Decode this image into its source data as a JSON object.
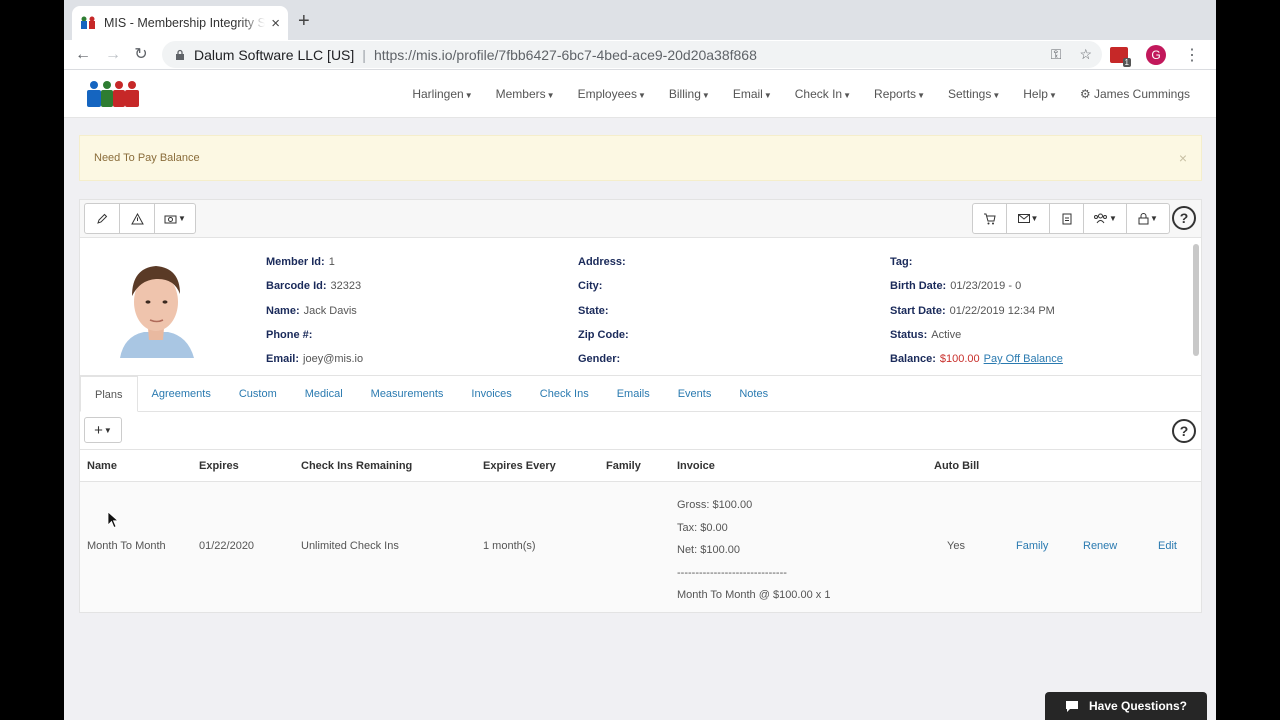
{
  "browser": {
    "tab_title": "MIS - Membership Integrity System",
    "new_tab": "+",
    "tab_close": "×",
    "site_name": "Dalum Software LLC [US]",
    "separator": "|",
    "url": "https://mis.io/profile/7fbb6427-6bc7-4bed-ace9-20d20a38f868",
    "profile_initial": "G",
    "extension_badge": "1"
  },
  "nav": {
    "items": [
      "Harlingen",
      "Members",
      "Employees",
      "Billing",
      "Email",
      "Check In",
      "Reports",
      "Settings",
      "Help"
    ],
    "user": "James Cummings"
  },
  "alert": {
    "message": "Need To Pay Balance",
    "close": "×"
  },
  "profile": {
    "col1": [
      {
        "label": "Member Id:",
        "value": "1"
      },
      {
        "label": "Barcode Id:",
        "value": "32323"
      },
      {
        "label": "Name:",
        "value": "Jack Davis"
      },
      {
        "label": "Phone #:",
        "value": ""
      },
      {
        "label": "Email:",
        "value": "joey@mis.io"
      }
    ],
    "col2": [
      {
        "label": "Address:",
        "value": ""
      },
      {
        "label": "City:",
        "value": ""
      },
      {
        "label": "State:",
        "value": ""
      },
      {
        "label": "Zip Code:",
        "value": ""
      },
      {
        "label": "Gender:",
        "value": ""
      }
    ],
    "col3": [
      {
        "label": "Tag:",
        "value": ""
      },
      {
        "label": "Birth Date:",
        "value": "01/23/2019 - 0"
      },
      {
        "label": "Start Date:",
        "value": "01/22/2019 12:34 PM"
      },
      {
        "label": "Status:",
        "value": "Active"
      },
      {
        "label": "Balance:",
        "value": "$100.00"
      }
    ],
    "pay_off_link": "Pay Off Balance"
  },
  "tabs": [
    "Plans",
    "Agreements",
    "Custom",
    "Medical",
    "Measurements",
    "Invoices",
    "Check Ins",
    "Emails",
    "Events",
    "Notes"
  ],
  "active_tab": "Plans",
  "add_button": "+",
  "help_symbol": "?",
  "plans_table": {
    "headers": {
      "name": "Name",
      "expires": "Expires",
      "checkins": "Check Ins Remaining",
      "every": "Expires Every",
      "family": "Family",
      "invoice": "Invoice",
      "autobill": "Auto Bill"
    },
    "rows": [
      {
        "name": "Month To Month",
        "expires": "01/22/2020",
        "checkins": "Unlimited Check Ins",
        "every": "1 month(s)",
        "invoice_gross": "Gross: $100.00",
        "invoice_tax": "Tax: $0.00",
        "invoice_net": "Net: $100.00",
        "invoice_rule": "------------------------------",
        "invoice_line": "Month To Month @ $100.00 x 1",
        "autobill": "Yes",
        "actions": [
          "Family",
          "Renew",
          "Edit"
        ]
      }
    ]
  },
  "chat": {
    "label": "Have Questions?"
  },
  "colors": {
    "link": "#2a7ab0",
    "alert_bg": "#fcf8e3",
    "balance": "#c9302c",
    "label": "#1a2a5a"
  }
}
